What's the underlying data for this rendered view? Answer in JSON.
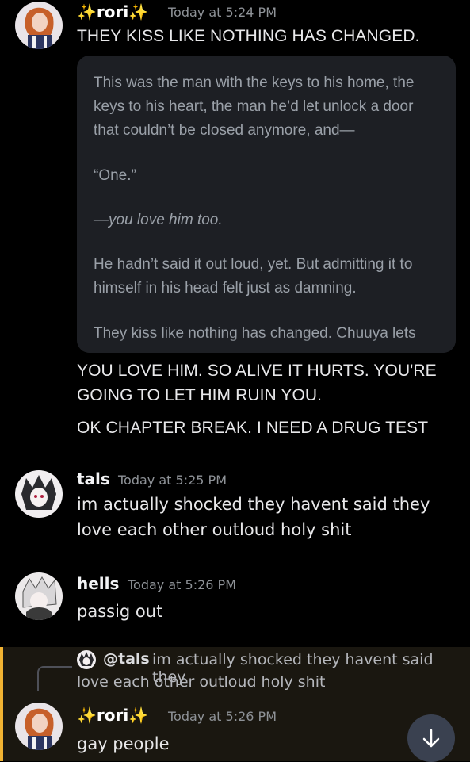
{
  "messages": [
    {
      "author": "rori",
      "sparkle_left": "✨",
      "sparkle_right": "✨",
      "timestamp": "Today at 5:24 PM",
      "lines": [
        "THEY KISS LIKE NOTHING HAS CHANGED."
      ],
      "embed": {
        "paragraphs": [
          "This was the man with the keys to his home, the keys to his heart, the man he’d let unlock a door that couldn’t be closed anymore, and—",
          "“One.”",
          "—you love him too.",
          "He hadn’t said it out loud, yet. But admitting it to himself in his head felt just as damning.",
          "They kiss like nothing has changed. Chuuya lets"
        ]
      },
      "after_lines": [
        "YOU LOVE HIM. SO ALIVE IT HURTS. YOU'RE",
        "GOING TO LET HIM RUIN YOU.",
        "OK CHAPTER BREAK. I NEED A DRUG TEST"
      ]
    },
    {
      "author": "tals",
      "timestamp": "Today at 5:25 PM",
      "lines": [
        "im actually shocked they havent said they",
        "love each other outloud holy shit"
      ]
    },
    {
      "author": "hells",
      "timestamp": "Today at 5:26 PM",
      "lines": [
        "passig out"
      ]
    },
    {
      "reply": {
        "mention": "@tals",
        "text_line1": "im actually shocked they havent said they",
        "text_line2": "love each other outloud holy shit"
      },
      "author": "rori",
      "sparkle_left": "✨",
      "sparkle_right": "✨",
      "timestamp": "Today at 5:26 PM",
      "lines": [
        "gay people"
      ]
    }
  ],
  "colors": {
    "highlight_bar": "#f0b232",
    "sparkle": "#f5c542"
  },
  "icons": {
    "scroll": "arrow-down-icon"
  }
}
